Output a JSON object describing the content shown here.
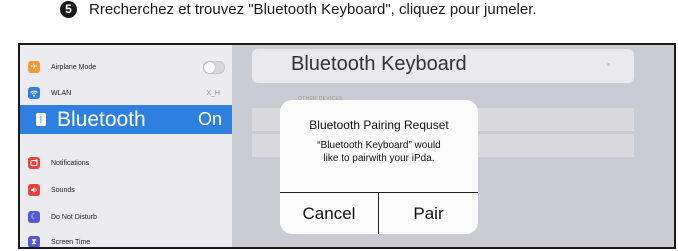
{
  "instruction": {
    "step_number": "5",
    "text": "Rrecherchez et trouvez \"Bluetooth Keyboard\", cliquez pour jumeler."
  },
  "sidebar": {
    "airplane_mode": {
      "label": "Airplane Mode",
      "toggle_on": false,
      "icon": "airplane-icon",
      "color": "#f19a37"
    },
    "wlan": {
      "label": "WLAN",
      "value": "X_H",
      "icon": "wifi-icon",
      "color": "#2f7fe0"
    },
    "bluetooth": {
      "label": "Bluetooth",
      "value": "On",
      "icon": "bluetooth-icon",
      "color": "#2f7fe0"
    },
    "notifications": {
      "label": "Notifications",
      "icon": "notifications-icon",
      "color": "#e6433a"
    },
    "sounds": {
      "label": "Sounds",
      "icon": "sounds-icon",
      "color": "#e6433a"
    },
    "do_not_disturb": {
      "label": "Do Not Disturb",
      "icon": "moon-icon",
      "color": "#5856d6"
    },
    "screen_time": {
      "label": "Screen Time",
      "icon": "hourglass-icon",
      "color": "#5856d6"
    }
  },
  "content": {
    "device_name": "Bluetooth Keyboard",
    "section_label": "OTHER DEVICES"
  },
  "dialog": {
    "title": "Bluetooth Pairing Requset",
    "message_line1": "“Bluetooth Keyboard” would",
    "message_line2": "like to pairwith your iPda.",
    "cancel_label": "Cancel",
    "pair_label": "Pair"
  }
}
